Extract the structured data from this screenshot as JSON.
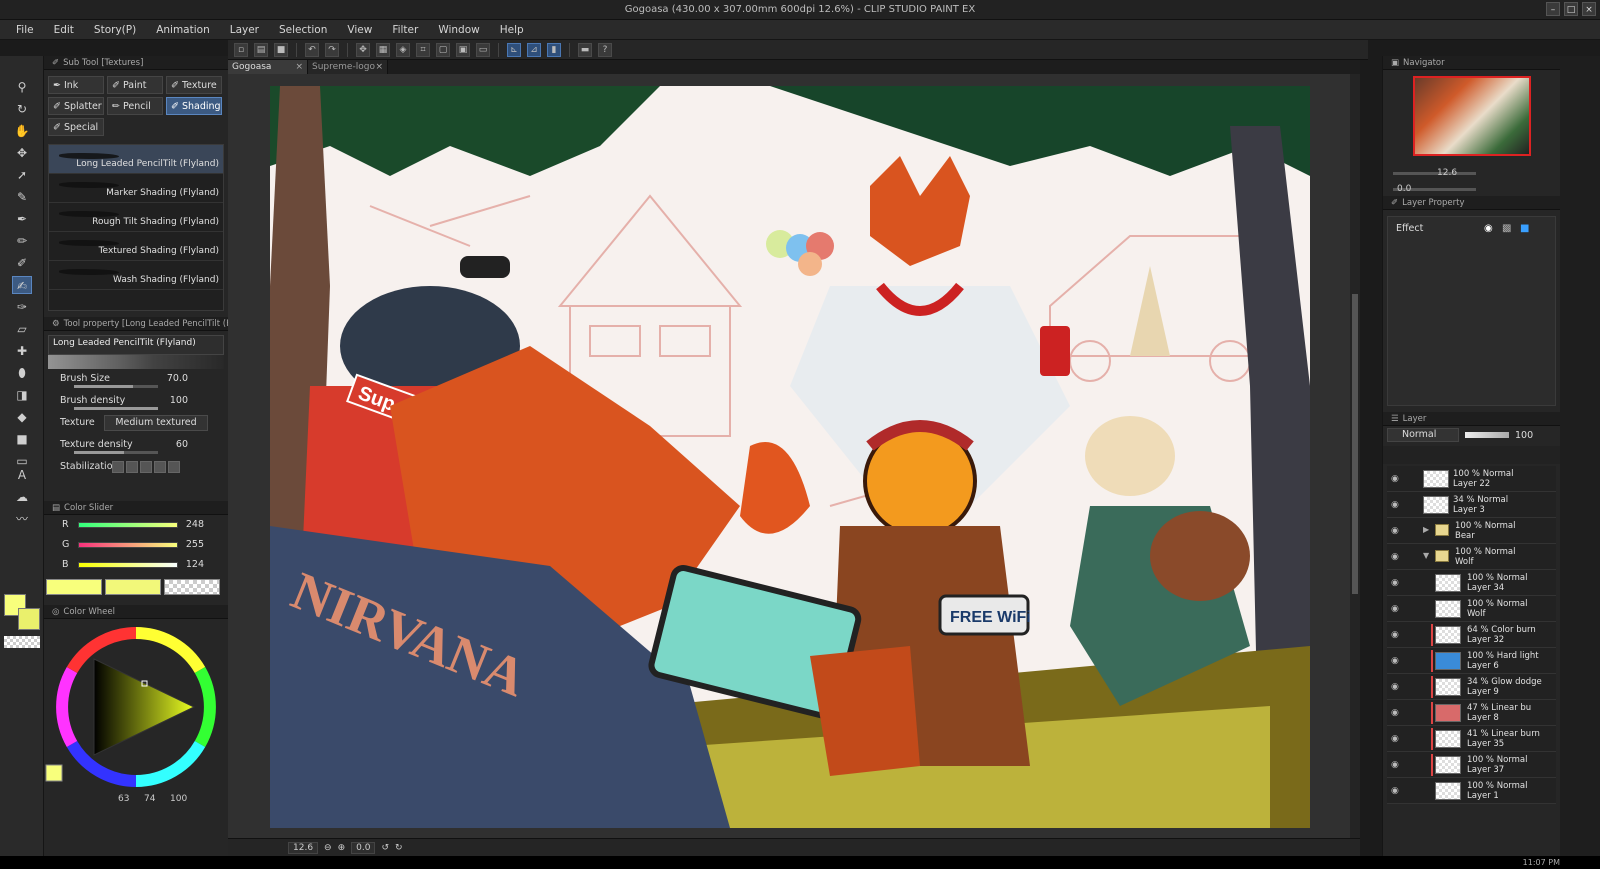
{
  "window": {
    "title": "Gogoasa (430.00 x 307.00mm 600dpi 12.6%) - CLIP STUDIO PAINT EX",
    "minimize": "–",
    "maximize": "□",
    "close": "×"
  },
  "menu": [
    "File",
    "Edit",
    "Story(P)",
    "Animation",
    "Layer",
    "Selection",
    "View",
    "Filter",
    "Window",
    "Help"
  ],
  "sub_tool": {
    "header": "Sub Tool [Textures]",
    "tabs": [
      "Ink",
      "Paint",
      "Texture",
      "Splatter",
      "Pencil",
      "Shading",
      "Special"
    ],
    "active_tab": "Shading",
    "brushes": [
      "Long Leaded PencilTilt (Flyland)",
      "Marker Shading (Flyland)",
      "Rough Tilt Shading (Flyland)",
      "Textured Shading (Flyland)",
      "Wash Shading (Flyland)"
    ]
  },
  "tool_property": {
    "header": "Tool property [Long Leaded PencilTilt (F",
    "brush_name": "Long Leaded PencilTilt (Flyland)",
    "brush_size_label": "Brush Size",
    "brush_size": "70.0",
    "brush_density_label": "Brush density",
    "brush_density": "100",
    "texture_label": "Texture",
    "texture_value": "Medium textured",
    "texture_density_label": "Texture density",
    "texture_density": "60",
    "stabilization_label": "Stabilization"
  },
  "color_slider": {
    "header": "Color Slider",
    "r_label": "R",
    "r": "248",
    "g_label": "G",
    "g": "255",
    "b_label": "B",
    "b": "124",
    "main_color": "#f8ff7c"
  },
  "color_wheel": {
    "header": "Color Wheel",
    "h": "63",
    "s": "74",
    "v": "100"
  },
  "doc_tabs": [
    {
      "name": "Gogoasa",
      "close": "×"
    },
    {
      "name": "Supreme-logo",
      "close": "×"
    }
  ],
  "status": {
    "zoom": "12.6",
    "rotation": "0.0"
  },
  "navigator": {
    "header": "Navigator",
    "zoom": "12.6",
    "rotation": "0.0"
  },
  "layer_property": {
    "header": "Layer Property",
    "effect_label": "Effect"
  },
  "layer_panel": {
    "header": "Layer",
    "blend_mode": "Normal",
    "opacity": "100",
    "layers": [
      {
        "line1": "100 %  Normal",
        "line2": "Layer 22"
      },
      {
        "line1": "34 %  Normal",
        "line2": "Layer 3"
      },
      {
        "line1": "100 %  Normal",
        "line2": "Bear"
      },
      {
        "line1": "100 %  Normal",
        "line2": "Wolf"
      },
      {
        "line1": "100 %  Normal",
        "line2": "Layer 34"
      },
      {
        "line1": "100 %  Normal",
        "line2": "Wolf"
      },
      {
        "line1": "64 %  Color burn",
        "line2": "Layer 32"
      },
      {
        "line1": "100 %  Hard light",
        "line2": "Layer 6"
      },
      {
        "line1": "34 %  Glow dodge",
        "line2": "Layer 9"
      },
      {
        "line1": "47 %  Linear bu",
        "line2": "Layer 8"
      },
      {
        "line1": "41 %  Linear burn",
        "line2": "Layer 35"
      },
      {
        "line1": "100 %  Normal",
        "line2": "Layer 37"
      },
      {
        "line1": "100 %  Normal",
        "line2": "Layer 1"
      }
    ]
  },
  "artwork": {
    "badge_text": "FREE WiFi",
    "shirt_text": "NIRVANA",
    "logo_text": "Sup"
  },
  "clock": "11:07 PM"
}
